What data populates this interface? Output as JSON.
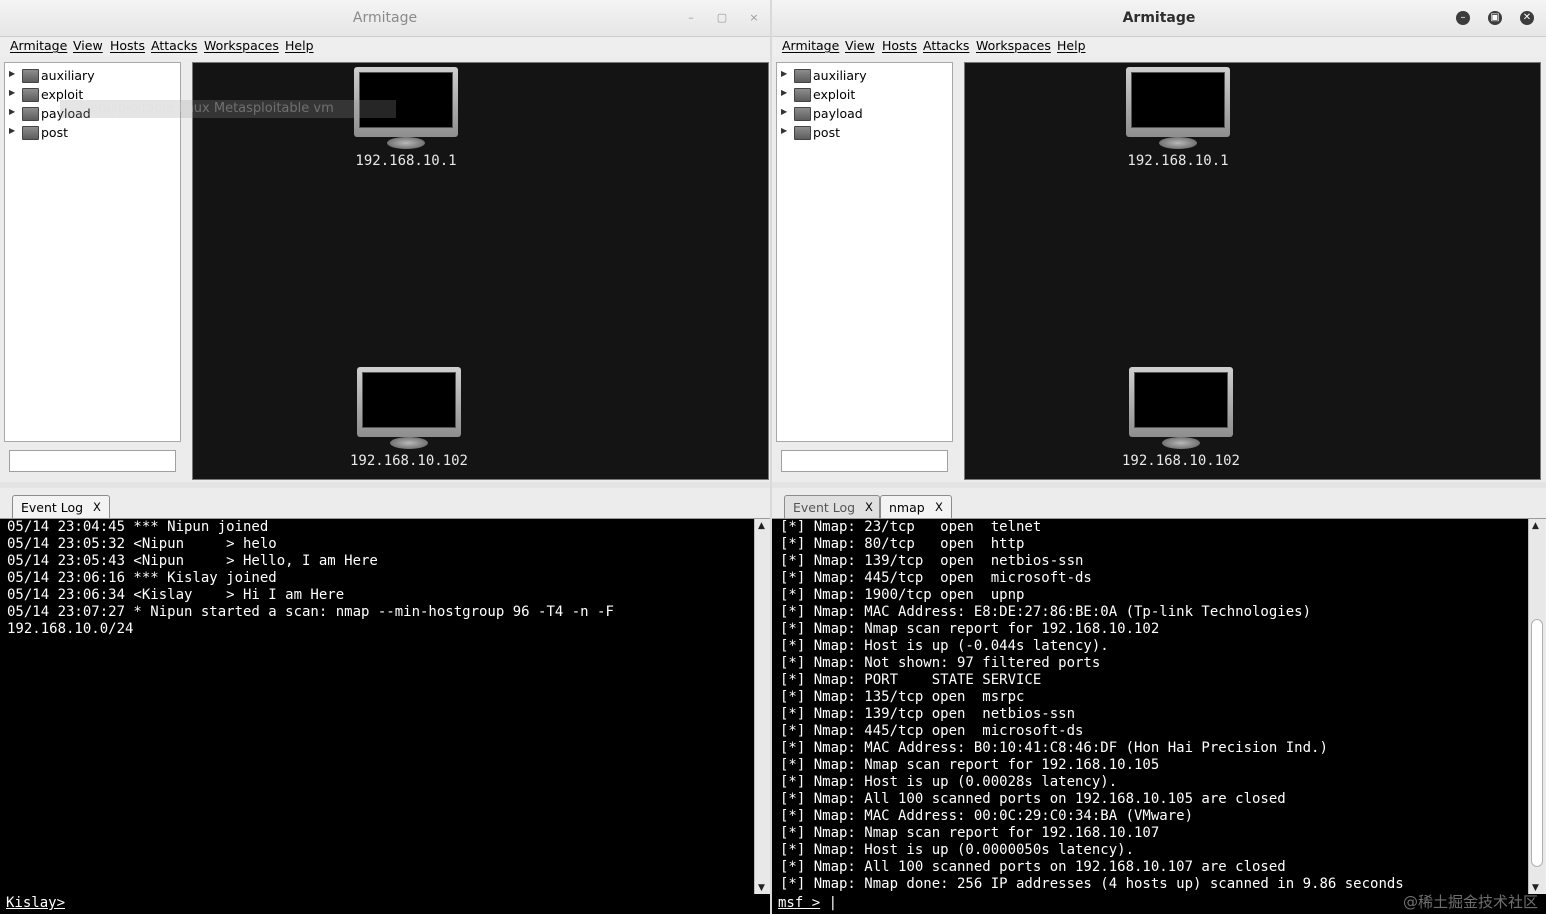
{
  "left": {
    "title": "Armitage",
    "win_buttons": [
      "–",
      "▢",
      "×"
    ],
    "menu": [
      "Armitage",
      "View",
      "Hosts",
      "Attacks",
      "Workspaces",
      "Help"
    ],
    "modules": [
      "auxiliary",
      "exploit",
      "payload",
      "post"
    ],
    "ghost_text": "etasploitable   linux Metasploitable vm",
    "hosts": [
      "192.168.10.1",
      "192.168.10.102"
    ],
    "tabs": [
      {
        "label": "Event Log",
        "close": "X"
      }
    ],
    "console_lines": [
      "05/14 23:04:45 *** Nipun joined",
      "05/14 23:05:32 <Nipun     > helo",
      "05/14 23:05:43 <Nipun     > Hello, I am Here",
      "05/14 23:06:16 *** Kislay joined",
      "05/14 23:06:34 <Kislay    > Hi I am Here",
      "05/14 23:07:27 * Nipun started a scan: nmap --min-hostgroup 96 -T4 -n -F",
      "192.168.10.0/24"
    ],
    "prompt": "Kislay>"
  },
  "right": {
    "title": "Armitage",
    "win_buttons": [
      "–",
      "▣",
      "✕"
    ],
    "menu": [
      "Armitage",
      "View",
      "Hosts",
      "Attacks",
      "Workspaces",
      "Help"
    ],
    "modules": [
      "auxiliary",
      "exploit",
      "payload",
      "post"
    ],
    "hosts": [
      "192.168.10.1",
      "192.168.10.102"
    ],
    "tabs": [
      {
        "label": "Event Log",
        "close": "X"
      },
      {
        "label": "nmap",
        "close": "X"
      }
    ],
    "console_lines": [
      "[*] Nmap: 23/tcp   open  telnet",
      "[*] Nmap: 80/tcp   open  http",
      "[*] Nmap: 139/tcp  open  netbios-ssn",
      "[*] Nmap: 445/tcp  open  microsoft-ds",
      "[*] Nmap: 1900/tcp open  upnp",
      "[*] Nmap: MAC Address: E8:DE:27:86:BE:0A (Tp-link Technologies)",
      "[*] Nmap: Nmap scan report for 192.168.10.102",
      "[*] Nmap: Host is up (-0.044s latency).",
      "[*] Nmap: Not shown: 97 filtered ports",
      "[*] Nmap: PORT    STATE SERVICE",
      "[*] Nmap: 135/tcp open  msrpc",
      "[*] Nmap: 139/tcp open  netbios-ssn",
      "[*] Nmap: 445/tcp open  microsoft-ds",
      "[*] Nmap: MAC Address: B0:10:41:C8:46:DF (Hon Hai Precision Ind.)",
      "[*] Nmap: Nmap scan report for 192.168.10.105",
      "[*] Nmap: Host is up (0.00028s latency).",
      "[*] Nmap: All 100 scanned ports on 192.168.10.105 are closed",
      "[*] Nmap: MAC Address: 00:0C:29:C0:34:BA (VMware)",
      "[*] Nmap: Nmap scan report for 192.168.10.107",
      "[*] Nmap: Host is up (0.0000050s latency).",
      "[*] Nmap: All 100 scanned ports on 192.168.10.107 are closed",
      "[*] Nmap: Nmap done: 256 IP addresses (4 hosts up) scanned in 9.86 seconds"
    ],
    "prompt": "msf >",
    "watermark": "@稀土掘金技术社区"
  }
}
